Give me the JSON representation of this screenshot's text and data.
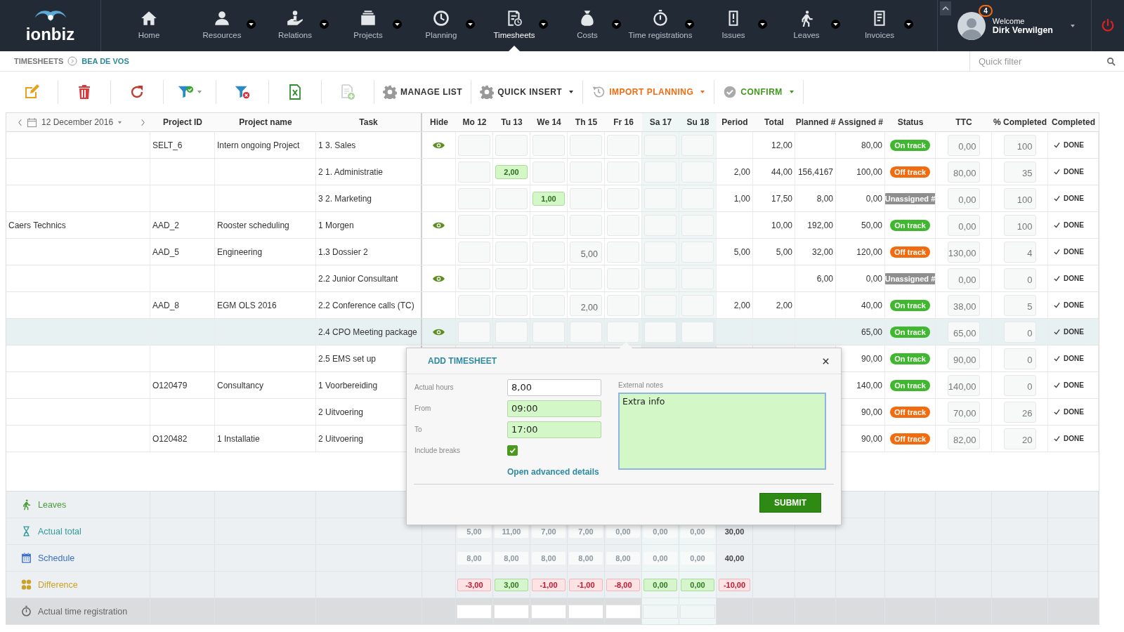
{
  "nav": {
    "logo": "ionbiz",
    "items": [
      {
        "label": "Home",
        "dropdown": false,
        "selected": false
      },
      {
        "label": "Resources",
        "dropdown": true,
        "selected": false
      },
      {
        "label": "Relations",
        "dropdown": true,
        "selected": false
      },
      {
        "label": "Projects",
        "dropdown": true,
        "selected": false
      },
      {
        "label": "Planning",
        "dropdown": true,
        "selected": false
      },
      {
        "label": "Timesheets",
        "dropdown": true,
        "selected": true
      },
      {
        "label": "Costs",
        "dropdown": true,
        "selected": false
      },
      {
        "label": "Time registrations",
        "dropdown": true,
        "selected": false
      },
      {
        "label": "Issues",
        "dropdown": true,
        "selected": false
      },
      {
        "label": "Leaves",
        "dropdown": true,
        "selected": false
      },
      {
        "label": "Invoices",
        "dropdown": true,
        "selected": false
      }
    ]
  },
  "user": {
    "notifications": "4",
    "greeting": "Welcome",
    "name": "Dirk Verwilgen"
  },
  "breadcrumb": [
    "TIMESHEETS",
    "BEA DE VOS"
  ],
  "quick_filter": {
    "placeholder": "Quick filter"
  },
  "toolbar": {
    "icon_buttons": [
      {
        "dropdown": false,
        "disabled": false
      },
      {
        "dropdown": false,
        "disabled": false
      },
      {
        "dropdown": false,
        "disabled": false
      },
      {
        "dropdown": true,
        "disabled": false
      },
      {
        "dropdown": false,
        "disabled": false
      },
      {
        "dropdown": false,
        "disabled": false
      },
      {
        "dropdown": false,
        "disabled": true
      }
    ],
    "actions": [
      {
        "label": "MANAGE LIST",
        "dropdown": false,
        "color": "#333333"
      },
      {
        "label": "QUICK INSERT",
        "dropdown": true,
        "color": "#333333"
      },
      {
        "label": "IMPORT PLANNING",
        "dropdown": true,
        "color": "#f26b0f"
      },
      {
        "label": "CONFIRM",
        "dropdown": true,
        "color": "#3d9a1c"
      }
    ]
  },
  "grid": {
    "date": "12 December 2016",
    "columns_left": [
      "Project ID",
      "Project name",
      "Task",
      "Hide"
    ],
    "days": [
      {
        "label": "Mo 12",
        "weekend": false
      },
      {
        "label": "Tu 13",
        "weekend": false
      },
      {
        "label": "We 14",
        "weekend": false
      },
      {
        "label": "Th 15",
        "weekend": false
      },
      {
        "label": "Fr 16",
        "weekend": false
      },
      {
        "label": "Sa 17",
        "weekend": true
      },
      {
        "label": "Su 18",
        "weekend": true
      }
    ],
    "columns_right": [
      "Period",
      "Total",
      "Planned #",
      "Assigned #",
      "Status",
      "TTC",
      "% Completed",
      "Completed"
    ],
    "rows": [
      {
        "project_id": "SELT_6",
        "project_name": "Intern ongoing Project",
        "task": "1 3. Sales",
        "hide": true,
        "selected": false,
        "days": [
          {
            "highlighted": false
          },
          {
            "highlighted": false
          },
          {
            "highlighted": false
          },
          {
            "highlighted": false
          },
          {
            "highlighted": false
          },
          {
            "highlighted": false
          },
          {
            "highlighted": false
          }
        ],
        "total": "12,00",
        "assigned": "80,00",
        "status": {
          "label": "On track",
          "kind": "on_track"
        },
        "ttc": "0,00",
        "pct": "100",
        "completed": "DONE"
      },
      {
        "task": "2 1. Administratie",
        "hide": false,
        "selected": false,
        "days": [
          {
            "highlighted": false
          },
          {
            "value": "2,00",
            "highlighted": true
          },
          {
            "highlighted": false
          },
          {
            "highlighted": false
          },
          {
            "highlighted": false
          },
          {
            "highlighted": false
          },
          {
            "highlighted": false
          }
        ],
        "period": "2,00",
        "total": "44,00",
        "planned": "156,4167",
        "assigned": "100,00",
        "status": {
          "label": "Off track",
          "kind": "off_track"
        },
        "ttc": "80,00",
        "pct": "35",
        "completed": "DONE"
      },
      {
        "task": "3 2. Marketing",
        "hide": false,
        "selected": false,
        "days": [
          {
            "highlighted": false
          },
          {
            "highlighted": false
          },
          {
            "value": "1,00",
            "highlighted": true
          },
          {
            "highlighted": false
          },
          {
            "highlighted": false
          },
          {
            "highlighted": false
          },
          {
            "highlighted": false
          }
        ],
        "period": "1,00",
        "total": "17,50",
        "planned": "8,00",
        "assigned": "0,00",
        "status": {
          "label": "Unassigned #",
          "kind": "unassigned"
        },
        "ttc": "0,00",
        "pct": "100",
        "completed": "DONE"
      },
      {
        "customer": "Caers Technics",
        "project_id": "AAD_2",
        "project_name": "Rooster scheduling",
        "task": "1 Morgen",
        "hide": true,
        "selected": false,
        "days": [
          {
            "highlighted": false
          },
          {
            "highlighted": false
          },
          {
            "highlighted": false
          },
          {
            "highlighted": false
          },
          {
            "highlighted": false
          },
          {
            "highlighted": false
          },
          {
            "highlighted": false
          }
        ],
        "total": "10,00",
        "planned": "192,00",
        "assigned": "50,00",
        "status": {
          "label": "On track",
          "kind": "on_track"
        },
        "ttc": "0,00",
        "pct": "100",
        "completed": "DONE"
      },
      {
        "project_id": "AAD_5",
        "project_name": "Engineering",
        "task": "1.3 Dossier 2",
        "hide": false,
        "selected": false,
        "days": [
          {
            "highlighted": false
          },
          {
            "highlighted": false
          },
          {
            "highlighted": false
          },
          {
            "value": "5,00",
            "highlighted": false
          },
          {
            "highlighted": false
          },
          {
            "highlighted": false
          },
          {
            "highlighted": false
          }
        ],
        "period": "5,00",
        "total": "5,00",
        "planned": "32,00",
        "assigned": "120,00",
        "status": {
          "label": "Off track",
          "kind": "off_track"
        },
        "ttc": "130,00",
        "pct": "4",
        "completed": "DONE"
      },
      {
        "task": "2.2 Junior Consultant",
        "hide": true,
        "selected": false,
        "days": [
          {
            "highlighted": false
          },
          {
            "highlighted": false
          },
          {
            "highlighted": false
          },
          {
            "highlighted": false
          },
          {
            "highlighted": false
          },
          {
            "highlighted": false
          },
          {
            "highlighted": false
          }
        ],
        "planned": "6,00",
        "assigned": "0,00",
        "status": {
          "label": "Unassigned #",
          "kind": "unassigned"
        },
        "ttc": "0,00",
        "pct": "0",
        "completed": "DONE"
      },
      {
        "project_id": "AAD_8",
        "project_name": "EGM OLS 2016",
        "task": "2.2 Conference calls (TC)",
        "hide": false,
        "selected": false,
        "days": [
          {
            "highlighted": false
          },
          {
            "highlighted": false
          },
          {
            "highlighted": false
          },
          {
            "value": "2,00",
            "highlighted": false
          },
          {
            "highlighted": false
          },
          {
            "highlighted": false
          },
          {
            "highlighted": false
          }
        ],
        "period": "2,00",
        "total": "2,00",
        "assigned": "40,00",
        "status": {
          "label": "On track",
          "kind": "on_track"
        },
        "ttc": "38,00",
        "pct": "5",
        "completed": "DONE"
      },
      {
        "task": "2.4 CPO Meeting package",
        "hide": true,
        "selected": true,
        "days": [
          {
            "highlighted": false
          },
          {
            "highlighted": false
          },
          {
            "highlighted": false
          },
          {
            "highlighted": false
          },
          {
            "highlighted": false
          },
          {
            "highlighted": false
          },
          {
            "highlighted": false
          }
        ],
        "assigned": "65,00",
        "status": {
          "label": "On track",
          "kind": "on_track"
        },
        "ttc": "65,00",
        "pct": "0",
        "completed": "DONE"
      },
      {
        "task": "2.5 EMS set up",
        "hide": false,
        "selected": false,
        "assigned": "90,00",
        "status": {
          "label": "On track",
          "kind": "on_track"
        },
        "ttc": "90,00",
        "pct": "0",
        "completed": "DONE"
      },
      {
        "project_id": "O120479",
        "project_name": "Consultancy",
        "task": "1 Voorbereiding",
        "hide": false,
        "selected": false,
        "assigned": "140,00",
        "status": {
          "label": "On track",
          "kind": "on_track"
        },
        "ttc": "140,00",
        "pct": "0",
        "completed": "DONE"
      },
      {
        "task": "2 Uitvoering",
        "hide": false,
        "selected": false,
        "assigned": "90,00",
        "status": {
          "label": "Off track",
          "kind": "off_track"
        },
        "ttc": "70,00",
        "pct": "26",
        "completed": "DONE"
      },
      {
        "project_id": "O120482",
        "project_name": "1 Installatie",
        "task": "2 Uitvoering",
        "hide": false,
        "selected": false,
        "assigned": "90,00",
        "status": {
          "label": "Off track",
          "kind": "off_track"
        },
        "ttc": "82,00",
        "pct": "20",
        "completed": "DONE"
      }
    ],
    "summary": [
      {
        "label": "Leaves",
        "color": "#4a9a3a",
        "kind": "values"
      },
      {
        "label": "Actual total",
        "color": "#2f9a9a",
        "kind": "values",
        "days": [
          {
            "value": "5,00",
            "kind": "plain"
          },
          {
            "value": "11,00",
            "kind": "plain"
          },
          {
            "value": "7,00",
            "kind": "plain"
          },
          {
            "value": "7,00",
            "kind": "plain"
          },
          {
            "value": "0,00",
            "kind": "plain"
          },
          {
            "value": "0,00",
            "kind": "plain"
          },
          {
            "value": "0,00",
            "kind": "plain"
          }
        ],
        "period": {
          "value": "30,00",
          "kind": "text"
        }
      },
      {
        "label": "Schedule",
        "color": "#3a6fc7",
        "kind": "values",
        "days": [
          {
            "value": "8,00",
            "kind": "plain"
          },
          {
            "value": "8,00",
            "kind": "plain"
          },
          {
            "value": "8,00",
            "kind": "plain"
          },
          {
            "value": "8,00",
            "kind": "plain"
          },
          {
            "value": "8,00",
            "kind": "plain"
          },
          {
            "value": "0,00",
            "kind": "plain"
          },
          {
            "value": "0,00",
            "kind": "plain"
          }
        ],
        "period": {
          "value": "40,00",
          "kind": "text"
        }
      },
      {
        "label": "Difference",
        "color": "#c9a227",
        "kind": "values",
        "days": [
          {
            "value": "-3,00",
            "kind": "negative"
          },
          {
            "value": "3,00",
            "kind": "positive"
          },
          {
            "value": "-1,00",
            "kind": "negative"
          },
          {
            "value": "-1,00",
            "kind": "negative"
          },
          {
            "value": "-8,00",
            "kind": "negative"
          },
          {
            "value": "0,00",
            "kind": "positive"
          },
          {
            "value": "0,00",
            "kind": "positive"
          }
        ],
        "period": {
          "value": "-10,00",
          "kind": "negative"
        }
      },
      {
        "label": "Actual time registration",
        "color": "#666666",
        "kind": "inputs"
      }
    ]
  },
  "popup": {
    "title": "ADD TIMESHEET",
    "fields": [
      {
        "label": "Actual hours",
        "value": "8,00",
        "highlighted": false
      },
      {
        "label": "From",
        "value": "09:00",
        "highlighted": true
      },
      {
        "label": "To",
        "value": "17:00",
        "highlighted": true
      }
    ],
    "include_breaks": {
      "label": "Include breaks",
      "checked": true
    },
    "link": "Open advanced details",
    "notes": {
      "label": "External notes",
      "value": "Extra info",
      "highlighted": true
    },
    "submit": "SUBMIT"
  }
}
